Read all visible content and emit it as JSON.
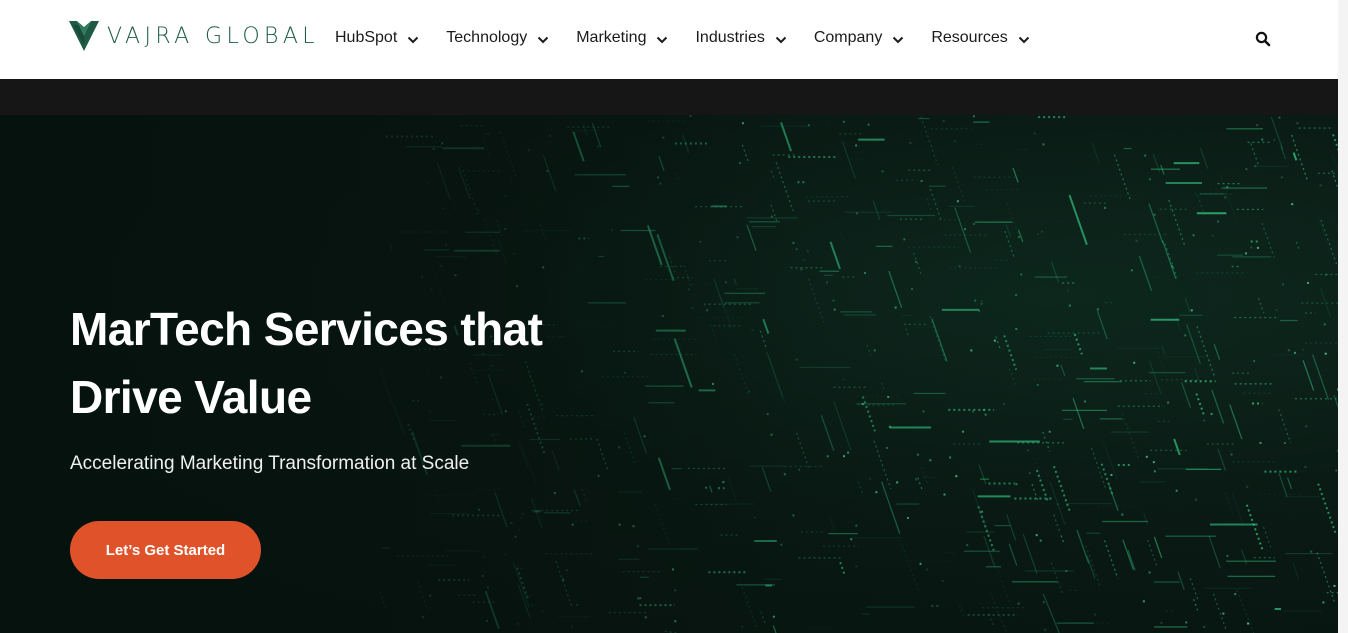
{
  "brand": {
    "logo_text": "VAJRA GLOBAL",
    "logo_icon": "vajra-v-logo-icon",
    "color": "#1f5a45"
  },
  "nav": {
    "items": [
      {
        "label": "HubSpot"
      },
      {
        "label": "Technology"
      },
      {
        "label": "Marketing"
      },
      {
        "label": "Industries"
      },
      {
        "label": "Company"
      },
      {
        "label": "Resources"
      }
    ],
    "dropdown_icon": "chevron-down-icon",
    "search_icon": "search-icon"
  },
  "hero": {
    "title_line1": "MarTech Services that",
    "title_line2": "Drive Value",
    "subtitle": "Accelerating Marketing Transformation at Scale",
    "cta_label": "Let’s Get Started",
    "cta_color": "#e0522a",
    "background": "green-circuit-data-visual"
  },
  "colors": {
    "header_bg": "#ffffff",
    "strip_bg": "#161616",
    "hero_bg": "#0a1a14",
    "accent": "#e0522a"
  }
}
